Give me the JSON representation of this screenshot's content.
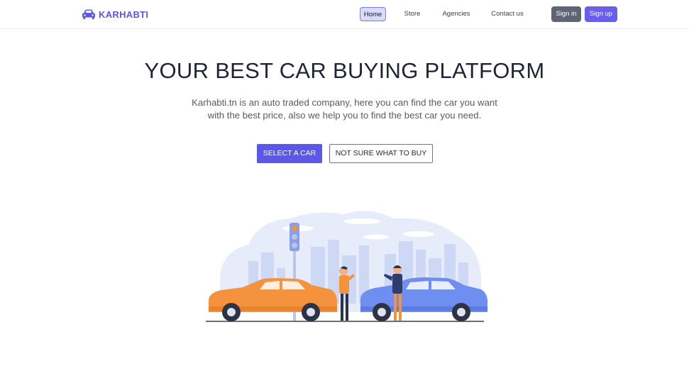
{
  "header": {
    "brand": "KARHABTI",
    "nav": [
      {
        "label": "Home",
        "active": true
      },
      {
        "label": "Store",
        "active": false
      },
      {
        "label": "Agencies",
        "active": false
      },
      {
        "label": "Contact us",
        "active": false
      }
    ],
    "sign_in": "Sign in",
    "sign_up": "Sign up"
  },
  "hero": {
    "title": "YOUR BEST CAR BUYING PLATFORM",
    "subtitle": "Karhabti.tn is an auto traded company, here you can find the car you want with the best price, also we help you to find the best car you need.",
    "primary_cta": "SELECT A CAR",
    "secondary_cta": "NOT SURE WHAT TO BUY"
  },
  "colors": {
    "accent": "#5b57e8",
    "accent_light": "#d9dafc",
    "signin_bg": "#5f6673",
    "car_orange": "#f5923e",
    "car_blue": "#6e8ff0"
  },
  "illustration": {
    "name": "car-accident-illustration"
  }
}
